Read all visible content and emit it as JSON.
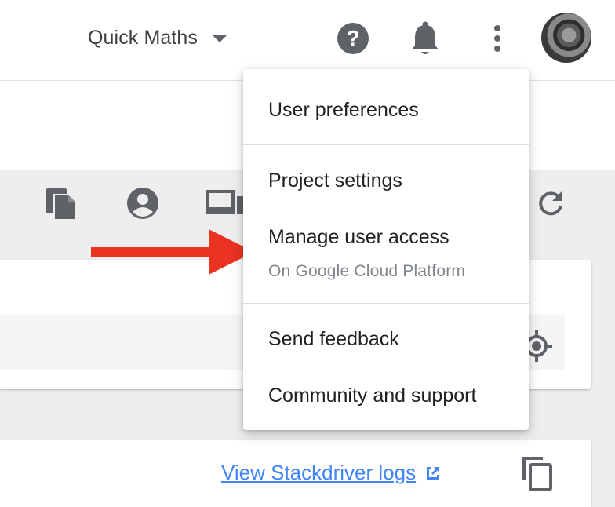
{
  "header": {
    "project_name": "Quick Maths",
    "icons": [
      "help-icon",
      "notifications-icon",
      "more-vert-icon",
      "avatar"
    ]
  },
  "toolbar": {
    "icons": [
      "copy-docs-icon",
      "account-icon",
      "devices-icon",
      "refresh-icon"
    ]
  },
  "menu": {
    "items": [
      {
        "label": "User preferences"
      },
      {
        "label": "Project settings"
      },
      {
        "label": "Manage user access",
        "sub": "On Google Cloud Platform"
      },
      {
        "label": "Send feedback"
      },
      {
        "label": "Community and support"
      }
    ]
  },
  "logs": {
    "link_label": "View Stackdriver logs"
  },
  "colors": {
    "annotation_arrow": "#ea3323",
    "link": "#4285f4",
    "icon": "#5f6368"
  }
}
